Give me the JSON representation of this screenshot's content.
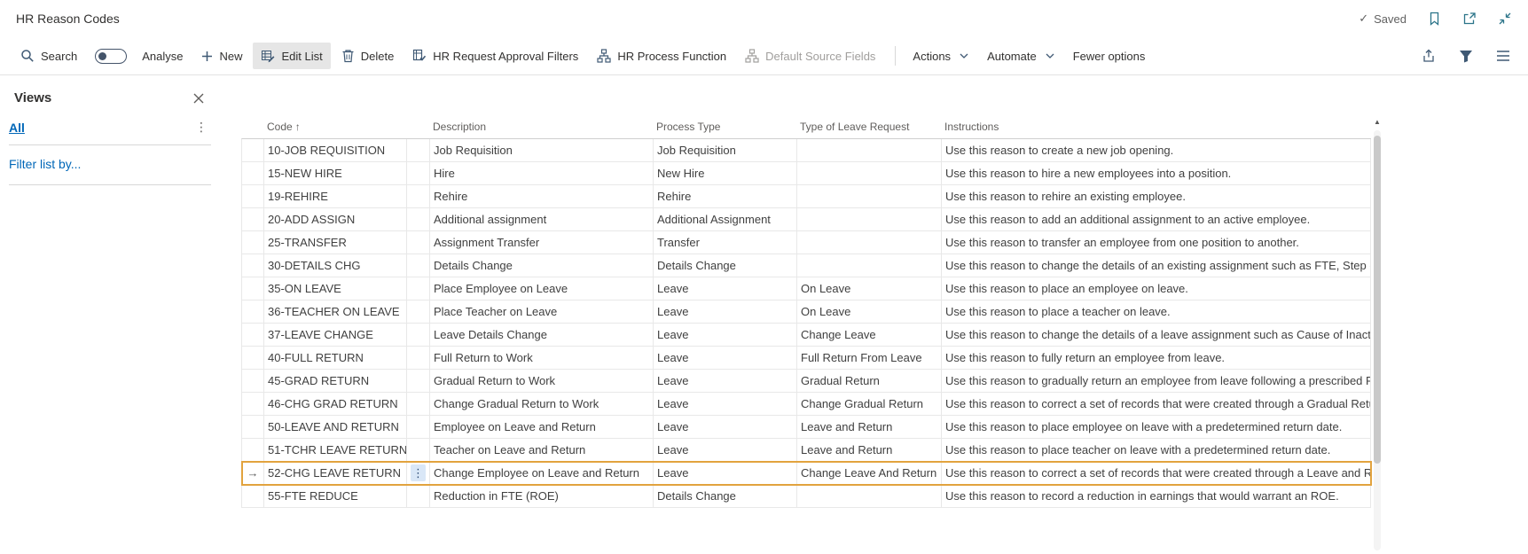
{
  "titlebar": {
    "title": "HR Reason Codes",
    "saved": "Saved"
  },
  "toolbar": {
    "search": "Search",
    "analyse": "Analyse",
    "new": "New",
    "edit_list": "Edit List",
    "delete": "Delete",
    "approval_filters": "HR Request Approval Filters",
    "process_function": "HR Process Function",
    "default_source_fields": "Default Source Fields",
    "actions": "Actions",
    "automate": "Automate",
    "fewer_options": "Fewer options"
  },
  "sidebar": {
    "title": "Views",
    "view_all": "All",
    "filter_by": "Filter list by..."
  },
  "icons": {
    "sort_asc": "↑",
    "row_arrow": "→",
    "ellipsis": "⋮",
    "check": "✓",
    "scroll_up": "▲"
  },
  "table": {
    "columns": [
      "Code",
      "Description",
      "Process Type",
      "Type of Leave Request",
      "Instructions"
    ],
    "sorted_by": "Code",
    "selected_code": "52-CHG LEAVE RETURN",
    "rows": [
      {
        "code": "10-JOB REQUISITION",
        "description": "Job Requisition",
        "process_type": "Job Requisition",
        "leave_type": "",
        "instructions": "Use this reason to create a new job opening."
      },
      {
        "code": "15-NEW HIRE",
        "description": "Hire",
        "process_type": "New Hire",
        "leave_type": "",
        "instructions": "Use this reason to hire a new employees into a position."
      },
      {
        "code": "19-REHIRE",
        "description": "Rehire",
        "process_type": "Rehire",
        "leave_type": "",
        "instructions": "Use this reason to rehire an existing employee."
      },
      {
        "code": "20-ADD ASSIGN",
        "description": "Additional assignment",
        "process_type": "Additional Assignment",
        "leave_type": "",
        "instructions": "Use this reason to add an additional assignment to an active employee."
      },
      {
        "code": "25-TRANSFER",
        "description": "Assignment Transfer",
        "process_type": "Transfer",
        "leave_type": "",
        "instructions": "Use this reason to transfer an employee from one position to another."
      },
      {
        "code": "30-DETAILS CHG",
        "description": "Details Change",
        "process_type": "Details Change",
        "leave_type": "",
        "instructions": "Use this reason to change the details of an existing assignment such as FTE, Step or G"
      },
      {
        "code": "35-ON LEAVE",
        "description": "Place Employee on Leave",
        "process_type": "Leave",
        "leave_type": "On Leave",
        "instructions": "Use this reason to place an employee on leave."
      },
      {
        "code": "36-TEACHER ON LEAVE",
        "description": "Place Teacher on Leave",
        "process_type": "Leave",
        "leave_type": "On Leave",
        "instructions": "Use this reason to place a teacher on leave."
      },
      {
        "code": "37-LEAVE CHANGE",
        "description": "Leave Details Change",
        "process_type": "Leave",
        "leave_type": "Change Leave",
        "instructions": "Use this reason to change the details of a leave assignment such as Cause of Inactivity"
      },
      {
        "code": "40-FULL RETURN",
        "description": "Full Return to Work",
        "process_type": "Leave",
        "leave_type": "Full Return From Leave",
        "instructions": "Use this reason to fully return an employee from leave."
      },
      {
        "code": "45-GRAD RETURN",
        "description": "Gradual Return to Work",
        "process_type": "Leave",
        "leave_type": "Gradual Return",
        "instructions": "Use this reason to gradually return an employee from leave following a prescribed RT"
      },
      {
        "code": "46-CHG GRAD RETURN",
        "description": "Change Gradual Return to Work",
        "process_type": "Leave",
        "leave_type": "Change Gradual Return",
        "instructions": "Use this reason to correct a set of records that were created through a Gradual Retur"
      },
      {
        "code": "50-LEAVE AND RETURN",
        "description": "Employee on Leave and Return",
        "process_type": "Leave",
        "leave_type": "Leave and Return",
        "instructions": "Use this reason to place employee on leave with a predetermined return date."
      },
      {
        "code": "51-TCHR LEAVE RETURN",
        "description": "Teacher on Leave and Return",
        "process_type": "Leave",
        "leave_type": "Leave and Return",
        "instructions": "Use this reason to place teacher on leave with a predetermined return date."
      },
      {
        "code": "52-CHG LEAVE RETURN",
        "description": "Change Employee on Leave and Return",
        "process_type": "Leave",
        "leave_type": "Change Leave And Return",
        "instructions": "Use this reason to correct a set of records that were created through a Leave and Retu"
      },
      {
        "code": "55-FTE REDUCE",
        "description": "Reduction in FTE (ROE)",
        "process_type": "Details Change",
        "leave_type": "",
        "instructions": "Use this reason to record a reduction in earnings that would warrant an ROE."
      }
    ]
  },
  "colors": {
    "link_blue": "#0067b8",
    "selected_row_border": "#e2a33e",
    "toolbar_icon": "#3f5974",
    "header_icon_teal": "#2b7489",
    "disabled_text": "#a19f9d"
  }
}
